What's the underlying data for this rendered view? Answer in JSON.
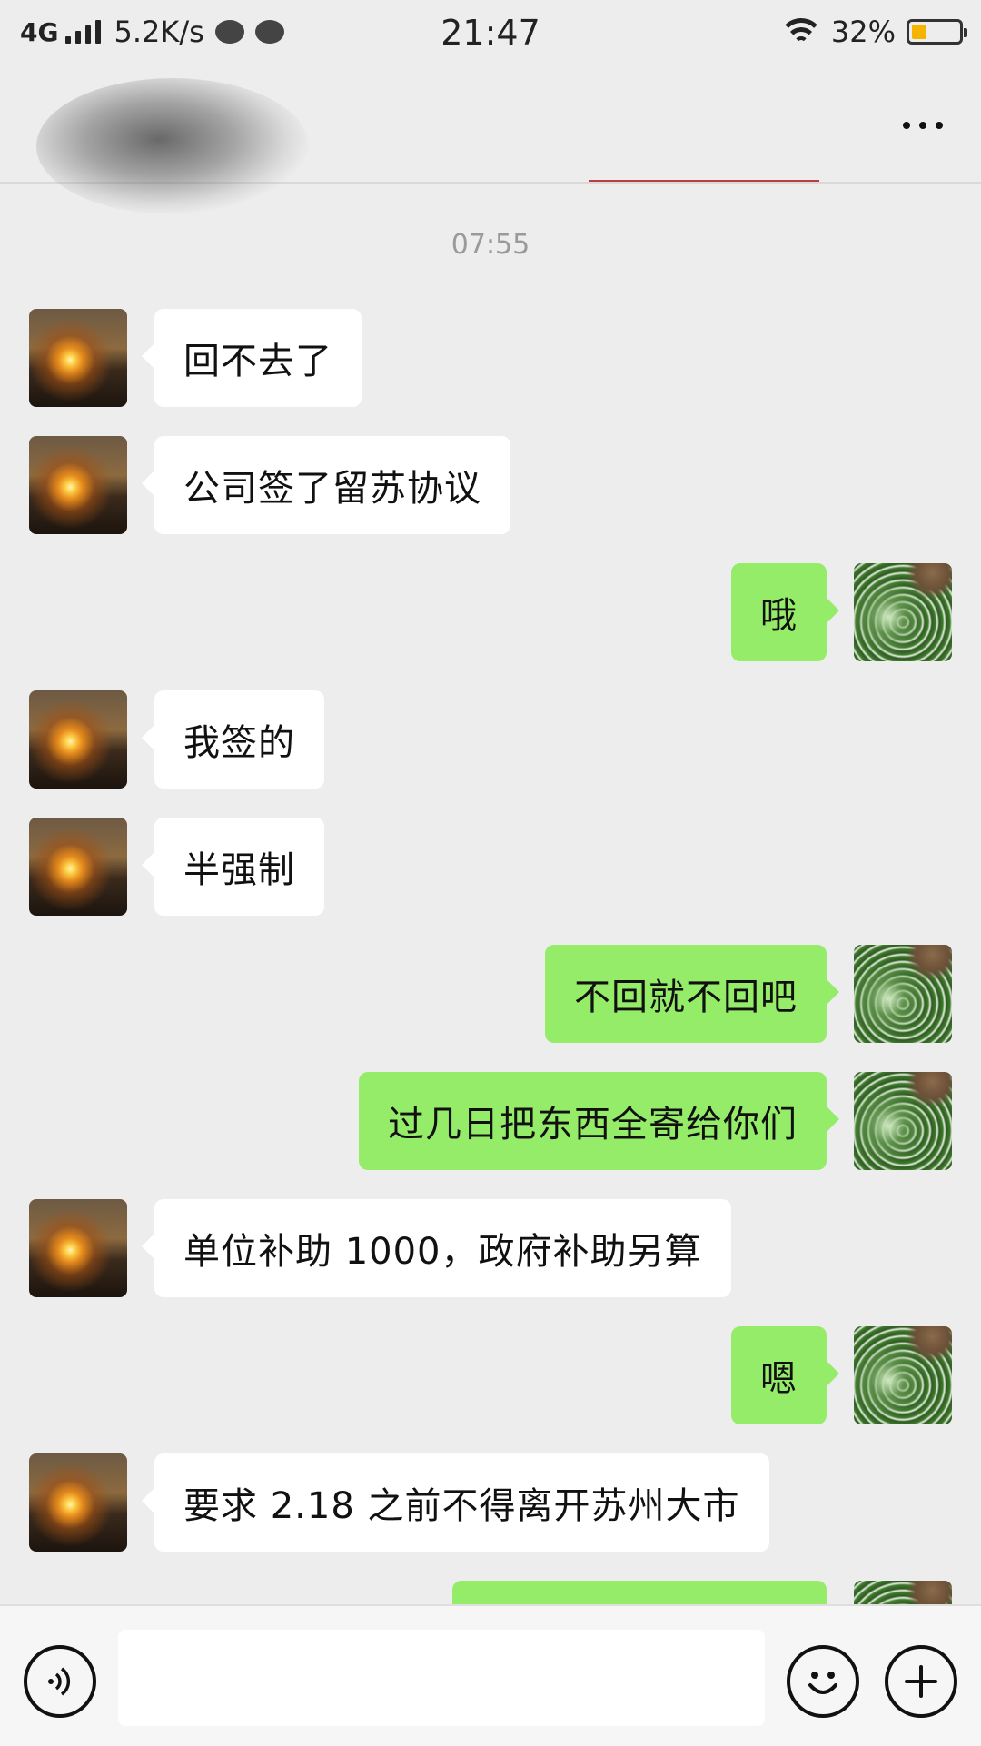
{
  "status_bar": {
    "network": "4G",
    "speed": "5.2K/s",
    "time": "21:47",
    "battery": "32%",
    "battery_level": 0.32,
    "battery_color": "#f4b400"
  },
  "header": {
    "more_icon": "more-horizontal-icon"
  },
  "chat": {
    "timestamp": "07:55",
    "messages": [
      {
        "side": "in",
        "text": "回不去了"
      },
      {
        "side": "in",
        "text": "公司签了留苏协议"
      },
      {
        "side": "out",
        "text": "哦"
      },
      {
        "side": "in",
        "text": "我签的"
      },
      {
        "side": "in",
        "text": "半强制"
      },
      {
        "side": "out",
        "text": "不回就不回吧"
      },
      {
        "side": "out",
        "text": "过几日把东西全寄给你们"
      },
      {
        "side": "in",
        "text": "单位补助 1000，政府补助另算"
      },
      {
        "side": "out",
        "text": "嗯"
      },
      {
        "side": "in",
        "text": "要求 2.18 之前不得离开苏州大市"
      },
      {
        "side": "out",
        "text": ""
      }
    ]
  },
  "input_bar": {
    "voice_icon": "voice-icon",
    "emoji_icon": "emoji-icon",
    "plus_icon": "plus-icon",
    "input_value": ""
  },
  "colors": {
    "background": "#ededed",
    "outgoing_bubble": "#95ec69",
    "incoming_bubble": "#ffffff"
  }
}
